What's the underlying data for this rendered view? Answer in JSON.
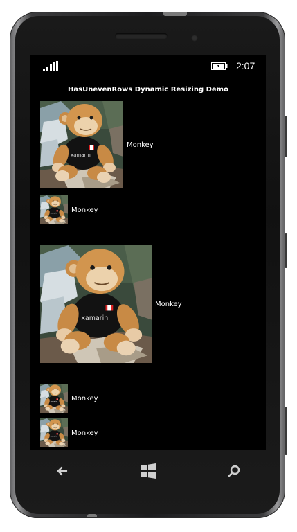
{
  "status_bar": {
    "time": "2:07",
    "signal_icon": "signal-bars-icon",
    "battery_icon": "battery-charging-icon"
  },
  "page": {
    "title": "HasUnevenRows Dynamic Resizing Demo"
  },
  "list": {
    "items": [
      {
        "label": "Monkey",
        "image": "monkey-photo",
        "size": "large"
      },
      {
        "label": "Monkey",
        "image": "monkey-photo",
        "size": "small"
      },
      {
        "label": "Monkey",
        "image": "monkey-photo",
        "size": "large"
      },
      {
        "label": "Monkey",
        "image": "monkey-photo",
        "size": "small"
      },
      {
        "label": "Monkey",
        "image": "monkey-photo",
        "size": "small"
      }
    ]
  },
  "nav": {
    "back_icon": "back-arrow-icon",
    "start_icon": "windows-start-icon",
    "search_icon": "search-icon"
  },
  "colors": {
    "screen_bg": "#000000",
    "text": "#ffffff"
  }
}
